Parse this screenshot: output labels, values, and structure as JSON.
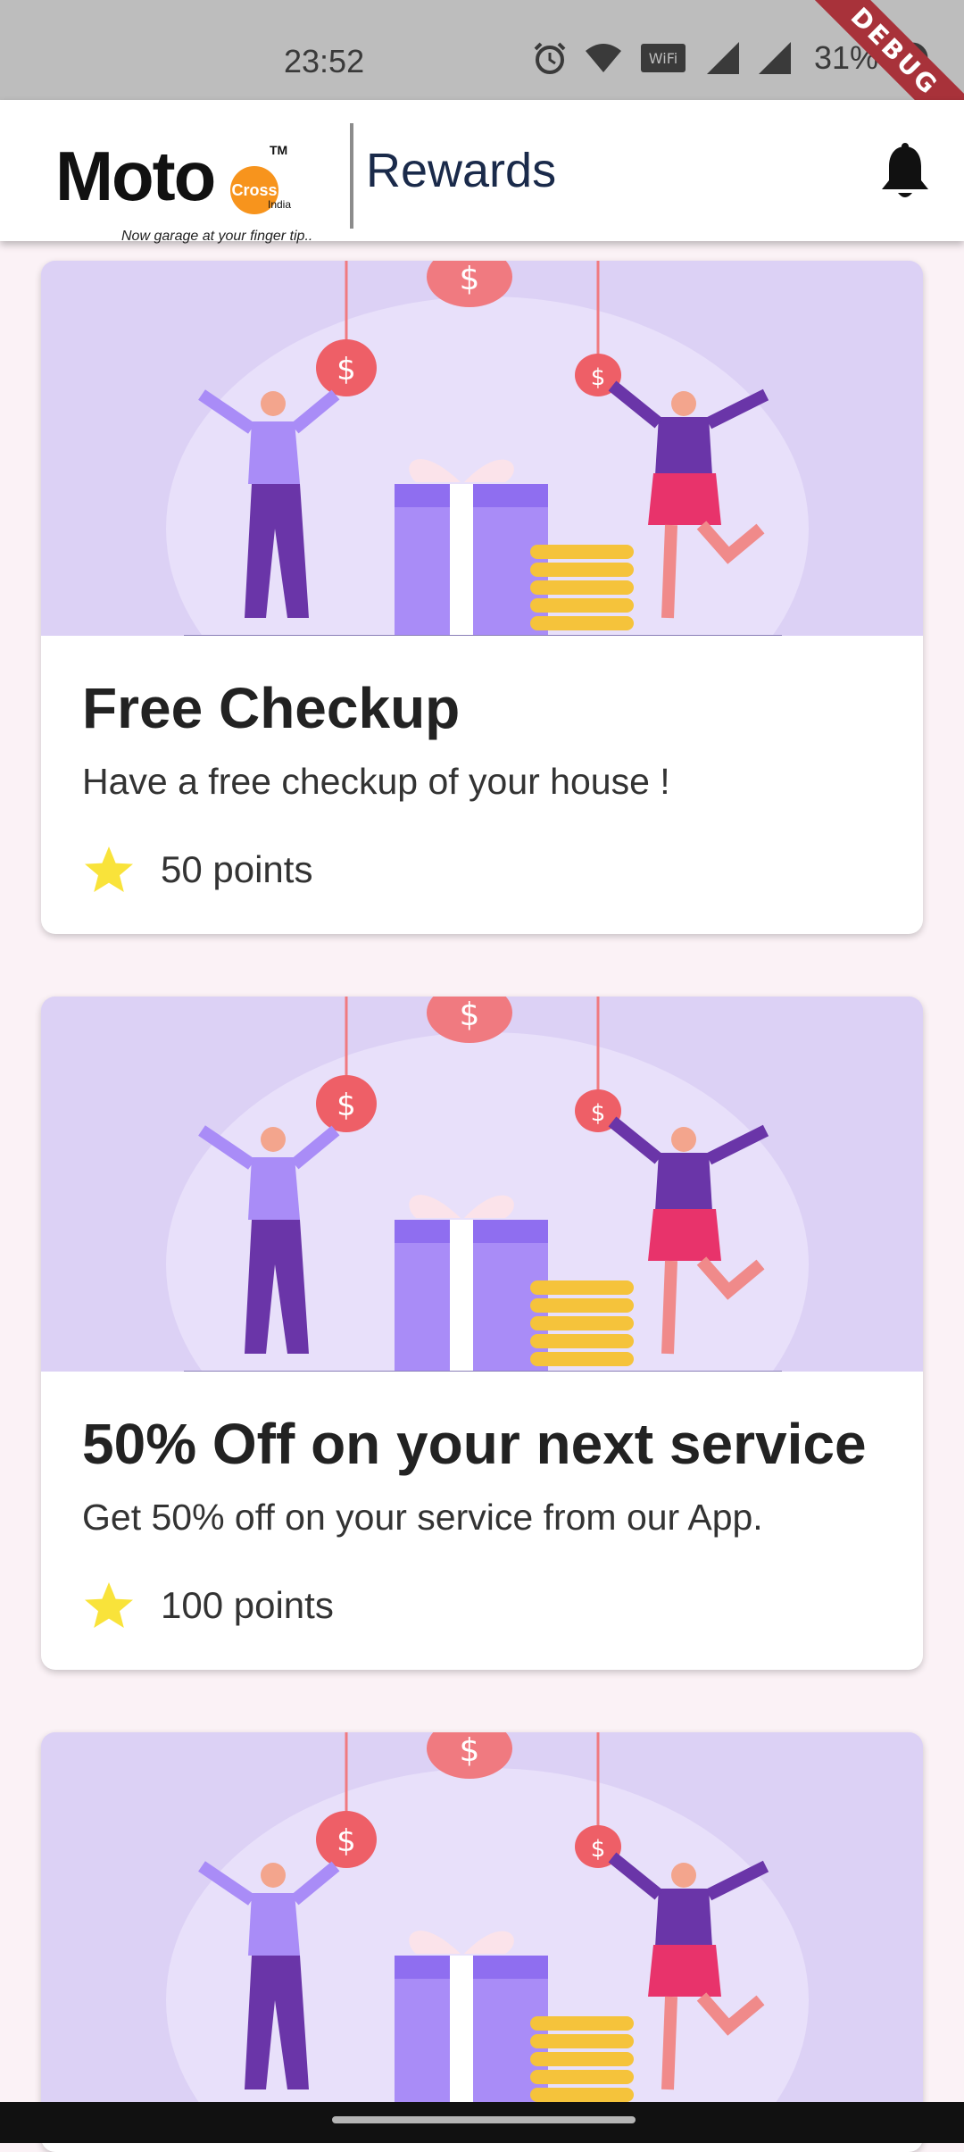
{
  "status_bar": {
    "time": "23:52",
    "battery": "31%",
    "debug_label": "DEBUG",
    "icons": [
      "alarm-icon",
      "wifi-icon",
      "vowifi-icon",
      "signal-icon",
      "signal-icon",
      "battery-icon"
    ]
  },
  "app_bar": {
    "logo_text": "Moto",
    "logo_badge": "Cross",
    "logo_tm": "TM",
    "logo_india": "India",
    "logo_tagline": "Now garage at your finger tip..",
    "title": "Rewards",
    "notification_icon": "bell-icon"
  },
  "rewards": [
    {
      "title": "Free Checkup",
      "description": "Have a free checkup of your house !",
      "points": "50 points"
    },
    {
      "title": "50% Off on your next service",
      "description": "Get 50% off on your service from our App.",
      "points": "100 points"
    },
    {
      "title": "",
      "description": "",
      "points": ""
    }
  ],
  "colors": {
    "background": "#fbf2f6",
    "illustration_bg": "#dcd1f5",
    "star": "#f9e33a",
    "accent_purple": "#8f6ef0"
  }
}
